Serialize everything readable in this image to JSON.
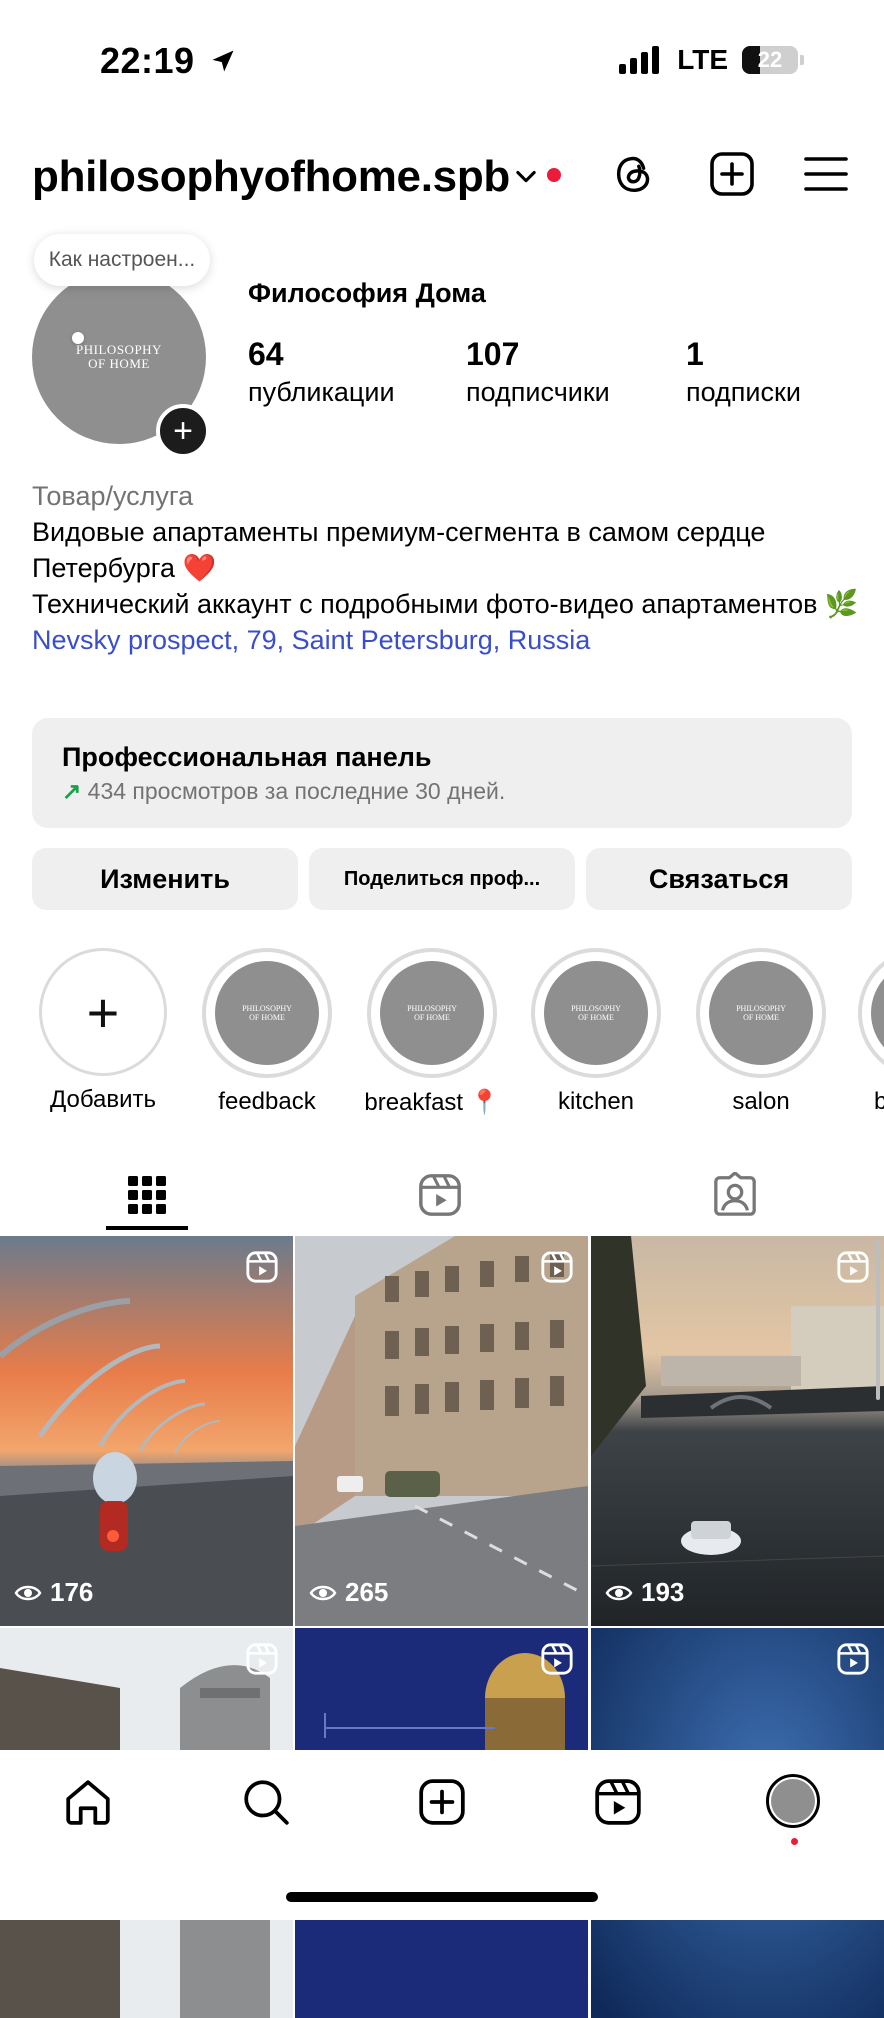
{
  "status": {
    "time": "22:19",
    "network": "LTE",
    "battery": "22"
  },
  "header": {
    "username": "philosophyofhome.spb"
  },
  "profile": {
    "avatar_text": "PHILOSOPHY\nOF HOME",
    "note": "Как настроен...",
    "display_name": "Философия Дома",
    "stats": [
      {
        "num": "64",
        "label": "публикации"
      },
      {
        "num": "107",
        "label": "подписчики"
      },
      {
        "num": "1",
        "label": "подписки"
      }
    ]
  },
  "bio": {
    "category": "Товар/услуга",
    "line1": "Видовые апартаменты премиум-сегмента в самом сердце Петербурга ❤️",
    "line2": "Технический аккаунт с подробными фото-видео апартаментов 🌿",
    "location": "Nevsky prospect, 79, Saint Petersburg, Russia"
  },
  "dashboard": {
    "title": "Профессиональная панель",
    "arrow": "↗",
    "subtitle": "434 просмотров за последние 30 дней."
  },
  "buttons": {
    "edit": "Изменить",
    "share": "Поделиться проф...",
    "contact": "Связаться"
  },
  "highlights": [
    {
      "label": "Добавить"
    },
    {
      "label": "feedback"
    },
    {
      "label": "breakfast 📍"
    },
    {
      "label": "kitchen"
    },
    {
      "label": "salon"
    },
    {
      "label": "b"
    }
  ],
  "highlight_cover_text": "PHILOSOPHY OF HOME",
  "grid": [
    {
      "views": "176"
    },
    {
      "views": "265"
    },
    {
      "views": "193"
    },
    {
      "views": ""
    },
    {
      "views": ""
    },
    {
      "views": ""
    }
  ],
  "colors": {
    "link": "#3a4ec9",
    "notification": "#ed1b3a",
    "panel": "#efefef",
    "trend": "#1aa04a"
  }
}
